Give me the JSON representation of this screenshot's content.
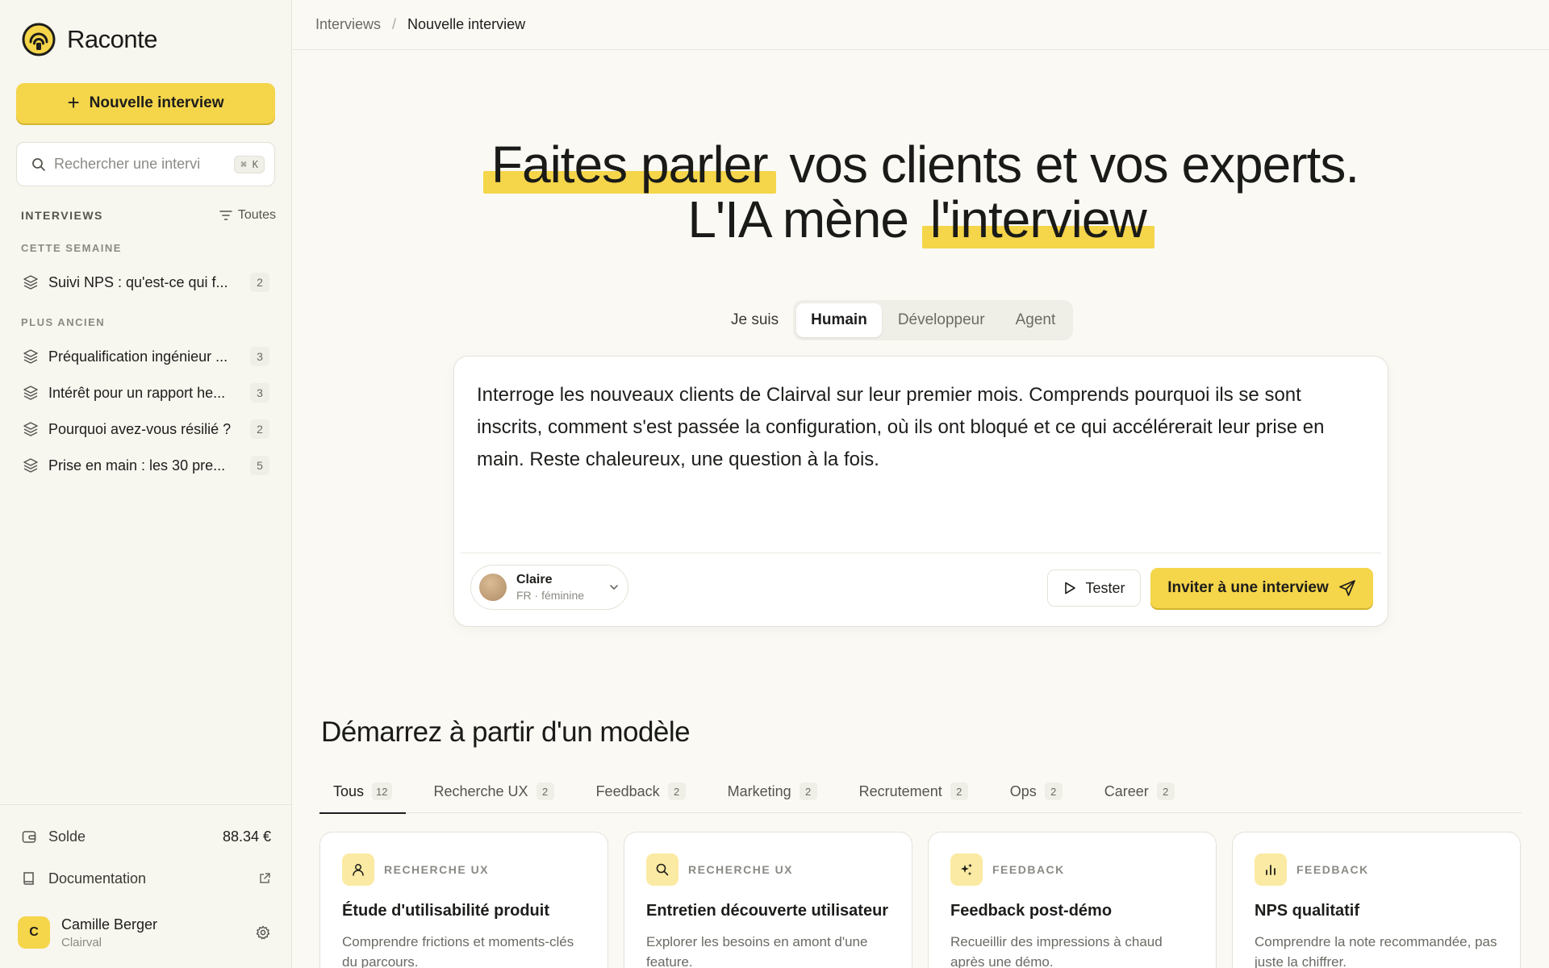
{
  "brand": {
    "name": "Raconte"
  },
  "sidebar": {
    "new_interview_label": "Nouvelle interview",
    "search": {
      "placeholder": "Rechercher une intervi",
      "shortcut": "⌘ K"
    },
    "section_title": "INTERVIEWS",
    "filter_label": "Toutes",
    "groups": [
      {
        "label": "CETTE SEMAINE",
        "items": [
          {
            "label": "Suivi NPS : qu'est-ce qui f...",
            "count": "2"
          }
        ]
      },
      {
        "label": "PLUS ANCIEN",
        "items": [
          {
            "label": "Préqualification ingénieur ...",
            "count": "3"
          },
          {
            "label": "Intérêt pour un rapport he...",
            "count": "3"
          },
          {
            "label": "Pourquoi avez-vous résilié ?",
            "count": "2"
          },
          {
            "label": "Prise en main : les 30 pre...",
            "count": "5"
          }
        ]
      }
    ],
    "balance": {
      "label": "Solde",
      "value": "88.34 €"
    },
    "documentation_label": "Documentation",
    "user": {
      "initial": "C",
      "name": "Camille Berger",
      "org": "Clairval"
    }
  },
  "breadcrumb": {
    "parent": "Interviews",
    "separator": "/",
    "current": "Nouvelle interview"
  },
  "hero": {
    "line1_highlight": "Faites parler",
    "line1_rest": "vos clients et vos experts.",
    "line2_rest": "L'IA mène",
    "line2_highlight": "l'interview"
  },
  "mode": {
    "label": "Je suis",
    "options": [
      "Humain",
      "Développeur",
      "Agent"
    ],
    "selected": "Humain"
  },
  "composer": {
    "prompt": "Interroge les nouveaux clients de Clairval sur leur premier mois. Comprends pourquoi ils se sont inscrits, comment s'est passée la configuration, où ils ont bloqué et ce qui accélérerait leur prise en main. Reste chaleureux, une question à la fois.",
    "voice": {
      "name": "Claire",
      "details": "FR · féminine"
    },
    "test_label": "Tester",
    "invite_label": "Inviter à une interview"
  },
  "templates": {
    "title": "Démarrez à partir d'un modèle",
    "tabs": [
      {
        "label": "Tous",
        "count": "12",
        "active": true
      },
      {
        "label": "Recherche UX",
        "count": "2"
      },
      {
        "label": "Feedback",
        "count": "2"
      },
      {
        "label": "Marketing",
        "count": "2"
      },
      {
        "label": "Recrutement",
        "count": "2"
      },
      {
        "label": "Ops",
        "count": "2"
      },
      {
        "label": "Career",
        "count": "2"
      }
    ],
    "cards": [
      {
        "icon": "user-icon",
        "category": "RECHERCHE UX",
        "title": "Étude d'utilisabilité produit",
        "description": "Comprendre frictions et moments-clés du parcours."
      },
      {
        "icon": "search-icon",
        "category": "RECHERCHE UX",
        "title": "Entretien découverte utilisateur",
        "description": "Explorer les besoins en amont d'une feature."
      },
      {
        "icon": "sparkles-icon",
        "category": "FEEDBACK",
        "title": "Feedback post-démo",
        "description": "Recueillir des impressions à chaud après une démo."
      },
      {
        "icon": "bar-chart-icon",
        "category": "FEEDBACK",
        "title": "NPS qualitatif",
        "description": "Comprendre la note recommandée, pas juste la chiffrer."
      }
    ]
  },
  "colors": {
    "accent": "#f5d54a",
    "accent_soft": "#fbeaa3",
    "background": "#faf9f4",
    "text": "#1d1d1b"
  }
}
